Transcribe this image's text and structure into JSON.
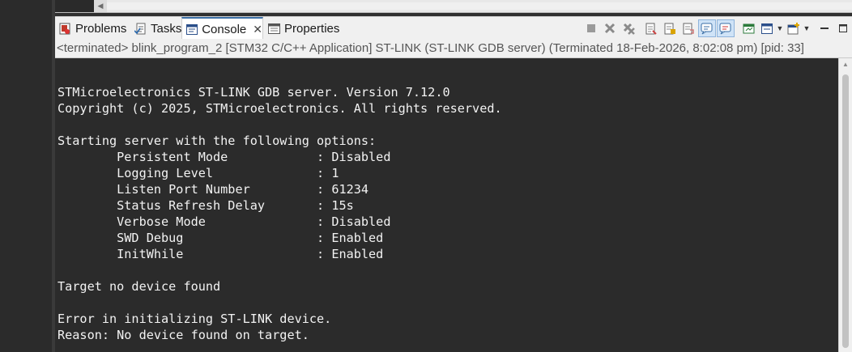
{
  "tabs": [
    {
      "label": "Problems",
      "icon": "problems-icon"
    },
    {
      "label": "Tasks",
      "icon": "tasks-icon"
    },
    {
      "label": "Console",
      "icon": "console-icon",
      "active": true,
      "closable": true
    },
    {
      "label": "Properties",
      "icon": "properties-icon"
    }
  ],
  "tab_close_glyph": "✕",
  "status_line": "<terminated> blink_program_2 [STM32 C/C++ Application] ST-LINK (ST-LINK GDB server) (Terminated 18-Feb-2026, 8:02:08 pm) [pid: 33]",
  "console": {
    "lines": [
      "STMicroelectronics ST-LINK GDB server. Version 7.12.0",
      "Copyright (c) 2025, STMicroelectronics. All rights reserved.",
      "",
      "Starting server with the following options:",
      "        Persistent Mode            : Disabled",
      "        Logging Level              : 1",
      "        Listen Port Number         : 61234",
      "        Status Refresh Delay       : 15s",
      "        Verbose Mode               : Disabled",
      "        SWD Debug                  : Enabled",
      "        InitWhile                  : Enabled",
      "",
      "Target no device found",
      "",
      "Error in initializing ST-LINK device.",
      "Reason: No device found on target."
    ]
  },
  "toolbar_icons": [
    "terminate-icon",
    "remove-launch-icon",
    "remove-all-terminated-icon",
    "clear-console-icon",
    "scroll-lock-icon",
    "word-wrap-icon",
    "show-on-stdout-icon",
    "show-on-stderr-icon",
    "pin-console-icon",
    "display-console-icon",
    "open-console-icon",
    "minimize-icon",
    "maximize-icon"
  ],
  "colors": {
    "console_bg": "#2b2b2b",
    "console_text": "#f2f2f2",
    "accent": "#3a6ea5"
  }
}
